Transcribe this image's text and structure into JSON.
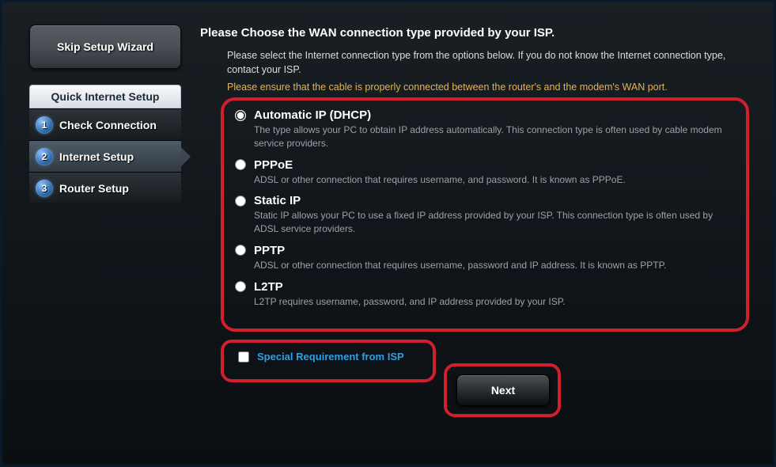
{
  "sidebar": {
    "skip_label": "Skip Setup Wizard",
    "wizard_title": "Quick Internet Setup",
    "steps": [
      {
        "num": "1",
        "label": "Check Connection"
      },
      {
        "num": "2",
        "label": "Internet Setup"
      },
      {
        "num": "3",
        "label": "Router Setup"
      }
    ],
    "active_index": 1
  },
  "main": {
    "heading": "Please Choose the WAN connection type provided by your ISP.",
    "description": "Please select the Internet connection type from the options below. If you do not know the Internet connection type, contact your ISP.",
    "warning": "Please ensure that the cable is properly connected between the router's and the modem's WAN port.",
    "options": [
      {
        "title": "Automatic IP (DHCP)",
        "desc": "The type allows your PC to obtain IP address automatically. This connection type is often used by cable modem service providers.",
        "selected": true
      },
      {
        "title": "PPPoE",
        "desc": "ADSL or other connection that requires username, and password. It is known as PPPoE.",
        "selected": false
      },
      {
        "title": "Static IP",
        "desc": "Static IP allows your PC to use a fixed IP address provided by your ISP. This connection type is often used by ADSL service providers.",
        "selected": false
      },
      {
        "title": "PPTP",
        "desc": "ADSL or other connection that requires username, password and IP address. It is known as PPTP.",
        "selected": false
      },
      {
        "title": "L2TP",
        "desc": "L2TP requires username, password, and IP address provided by your ISP.",
        "selected": false
      }
    ],
    "special_label": "Special Requirement from ISP",
    "next_label": "Next"
  },
  "colors": {
    "highlight": "#d21f2b",
    "link": "#2f9fe0",
    "warn": "#e8b347"
  }
}
